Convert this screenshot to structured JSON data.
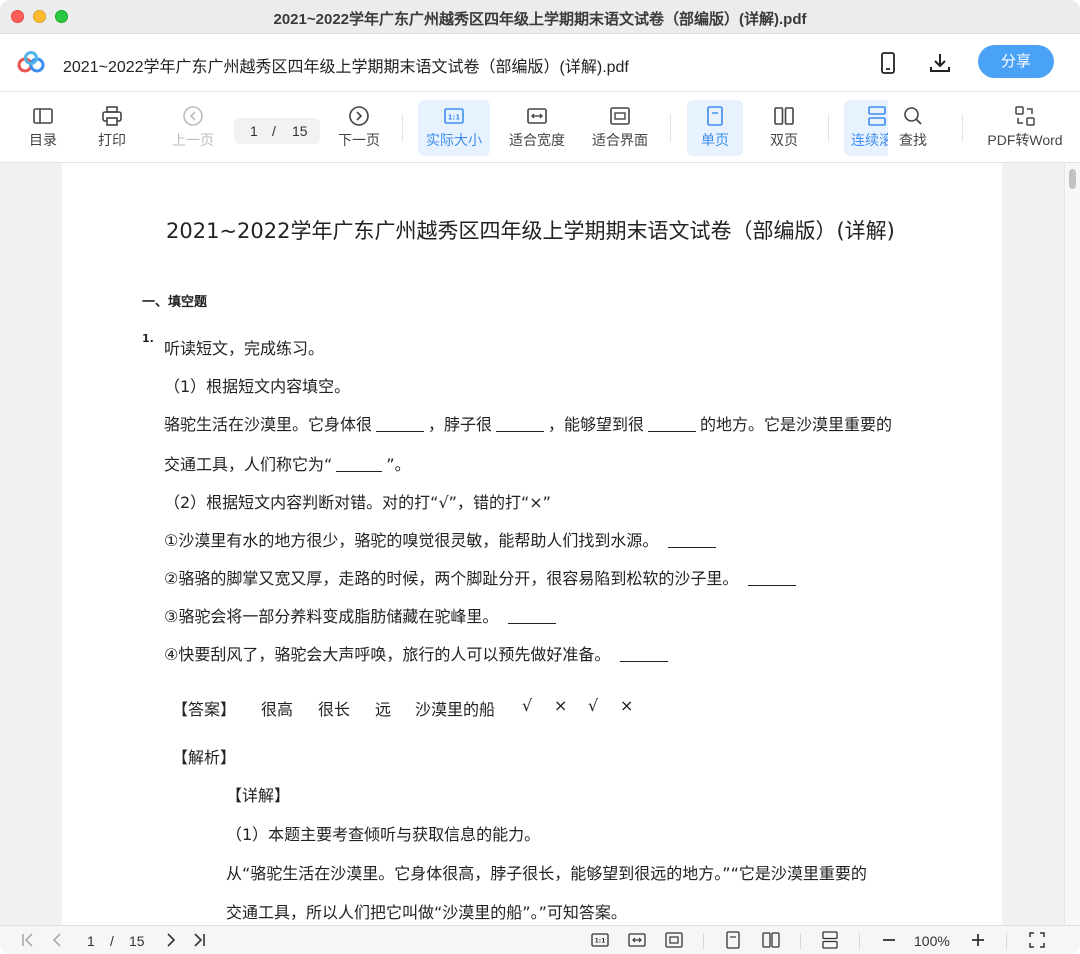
{
  "window": {
    "title": "2021~2022学年广东广州越秀区四年级上学期期末语文试卷（部编版）(详解).pdf"
  },
  "header": {
    "doc_name": "2021~2022学年广东广州越秀区四年级上学期期末语文试卷（部编版）(详解).pdf",
    "share_label": "分享"
  },
  "toolbar": {
    "toc": "目录",
    "print": "打印",
    "prev": "上一页",
    "current_page": "1",
    "page_sep": "/",
    "total_pages": "15",
    "next": "下一页",
    "actual_size": "实际大小",
    "fit_width": "适合宽度",
    "fit_window": "适合界面",
    "single_page": "单页",
    "double_page": "双页",
    "continuous": "连续滚",
    "find": "查找",
    "pdf_to_word": "PDF转Word",
    "accent_color": "#3d8ef0"
  },
  "document": {
    "title": "2021~2022学年广东广州越秀区四年级上学期期末语文试卷（部编版）(详解)",
    "section": "一、填空题",
    "q_number": "1.",
    "q_text": "听读短文，完成练习。",
    "part1": "（1）根据短文内容填空。",
    "l1a": "骆驼生活在沙漠里。它身体很",
    "l1b": "，脖子很",
    "l1c": "，能够望到很",
    "l1d": "的地方。它是沙漠里重要的",
    "l2a": "交通工具，人们称它为“",
    "l2b": "”。",
    "part2": "（2）根据短文内容判断对错。对的打“√”，错的打“×”",
    "j1": "①沙漠里有水的地方很少，骆驼的嗅觉很灵敏，能帮助人们找到水源。",
    "j2": "②骆骆的脚掌又宽又厚，走路的时候，两个脚趾分开，很容易陷到松软的沙子里。",
    "j3": "③骆驼会将一部分养料变成脂肪储藏在驼峰里。",
    "j4": "④快要刮风了，骆驼会大声呼唤，旅行的人可以预先做好准备。",
    "answer_label": "【答案】",
    "answers": [
      "很高",
      "很长",
      "远",
      "沙漠里的船",
      "√",
      "×",
      "√",
      "×"
    ],
    "analysis_label": "【解析】",
    "detail_label": "【详解】",
    "d1": "（1）本题主要考查倾听与获取信息的能力。",
    "d2": "从“骆驼生活在沙漠里。它身体很高，脖子很长，能够望到很远的地方。”“它是沙漠里重要的",
    "d3": "交通工具，所以人们把它叫做“沙漠里的船”。”可知答案。"
  },
  "bottombar": {
    "current_page": "1",
    "page_sep": "/",
    "total_pages": "15",
    "zoom": "100%"
  }
}
